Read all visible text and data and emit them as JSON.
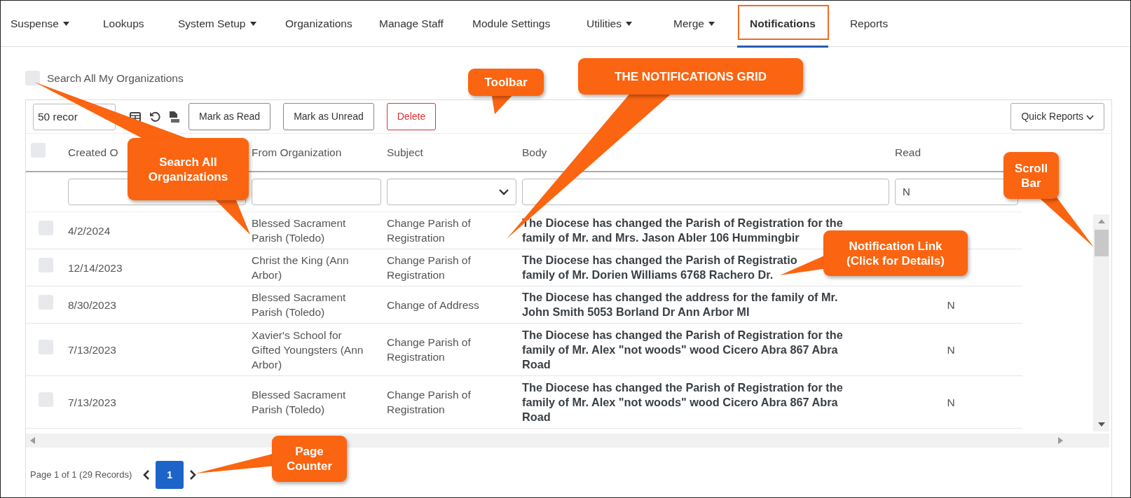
{
  "nav": {
    "items": [
      {
        "label": "Suspense",
        "dropdown": true,
        "selected": false
      },
      {
        "label": "Lookups",
        "dropdown": false,
        "selected": false
      },
      {
        "label": "System Setup",
        "dropdown": true,
        "selected": false
      },
      {
        "label": "Organizations",
        "dropdown": false,
        "selected": false
      },
      {
        "label": "Manage Staff",
        "dropdown": false,
        "selected": false
      },
      {
        "label": "Module Settings",
        "dropdown": false,
        "selected": false
      },
      {
        "label": "Utilities",
        "dropdown": true,
        "selected": false
      },
      {
        "label": "Merge",
        "dropdown": true,
        "selected": false
      },
      {
        "label": "Notifications",
        "dropdown": false,
        "selected": true
      },
      {
        "label": "Reports",
        "dropdown": false,
        "selected": false
      }
    ]
  },
  "search_all": {
    "label": "Search All My Organizations",
    "checked": false
  },
  "toolbar": {
    "records": "50 recor",
    "buttons": [
      {
        "label": "Mark as Read",
        "kind": "default"
      },
      {
        "label": "Mark as Unread",
        "kind": "default"
      },
      {
        "label": "Delete",
        "kind": "danger"
      }
    ],
    "quick_reports": "Quick Reports"
  },
  "grid": {
    "select_all_checked": false,
    "columns": [
      "Created O",
      "From Organization",
      "Subject",
      "Body",
      "Read"
    ],
    "read_filter": "N",
    "rows": [
      {
        "checked": false,
        "created": "4/2/2024",
        "from": "Blessed Sacrament Parish (Toledo)",
        "subject": "Change Parish of Registration",
        "body": [
          "The Diocese has changed the Parish of Registration for the",
          "family of Mr. and Mrs. Jason Abler 106 Hummingbir"
        ]
      },
      {
        "checked": false,
        "created": "12/14/2023",
        "from": "Christ the King (Ann Arbor)",
        "subject": "Change Parish of Registration",
        "body": [
          "The Diocese has changed the Parish of Registratio",
          "family of Mr. Dorien Williams 6768 Rachero Dr."
        ]
      },
      {
        "checked": false,
        "created": "8/30/2023",
        "from": "Blessed Sacrament Parish (Toledo)",
        "subject": "Change of Address",
        "body": [
          "The Diocese has changed the address for the family of Mr.",
          "John Smith 5053 Borland Dr Ann Arbor MI"
        ],
        "read": "N"
      },
      {
        "checked": false,
        "created": "7/13/2023",
        "from": "Xavier's School for Gifted Youngsters (Ann Arbor)",
        "subject": "Change Parish of Registration",
        "body": [
          "The Diocese has changed the Parish of Registration for the",
          "family of Mr. Alex \"not woods\" wood Cicero Abra 867 Abra",
          "Road"
        ],
        "read": "N"
      },
      {
        "checked": false,
        "created": "7/13/2023",
        "from": "Blessed Sacrament Parish (Toledo)",
        "subject": "Change Parish of Registration",
        "body": [
          "The Diocese has changed the Parish of Registration for the",
          "family of Mr. Alex \"not woods\" wood Cicero Abra 867 Abra",
          "Road"
        ],
        "read": "N"
      }
    ]
  },
  "pager": {
    "summary": "Page 1 of 1 (29 Records)",
    "pages": [
      {
        "label": "1",
        "selected": true
      }
    ]
  },
  "callouts": [
    {
      "lines": [
        "Search All",
        "Organizations"
      ]
    },
    {
      "lines": [
        "Toolbar"
      ]
    },
    {
      "lines": [
        "THE NOTIFICATIONS GRID"
      ]
    },
    {
      "lines": [
        "Scroll",
        "Bar"
      ]
    },
    {
      "lines": [
        "Notification Link",
        "(Click for Details)"
      ]
    },
    {
      "lines": [
        "Page",
        "Counter"
      ]
    }
  ]
}
